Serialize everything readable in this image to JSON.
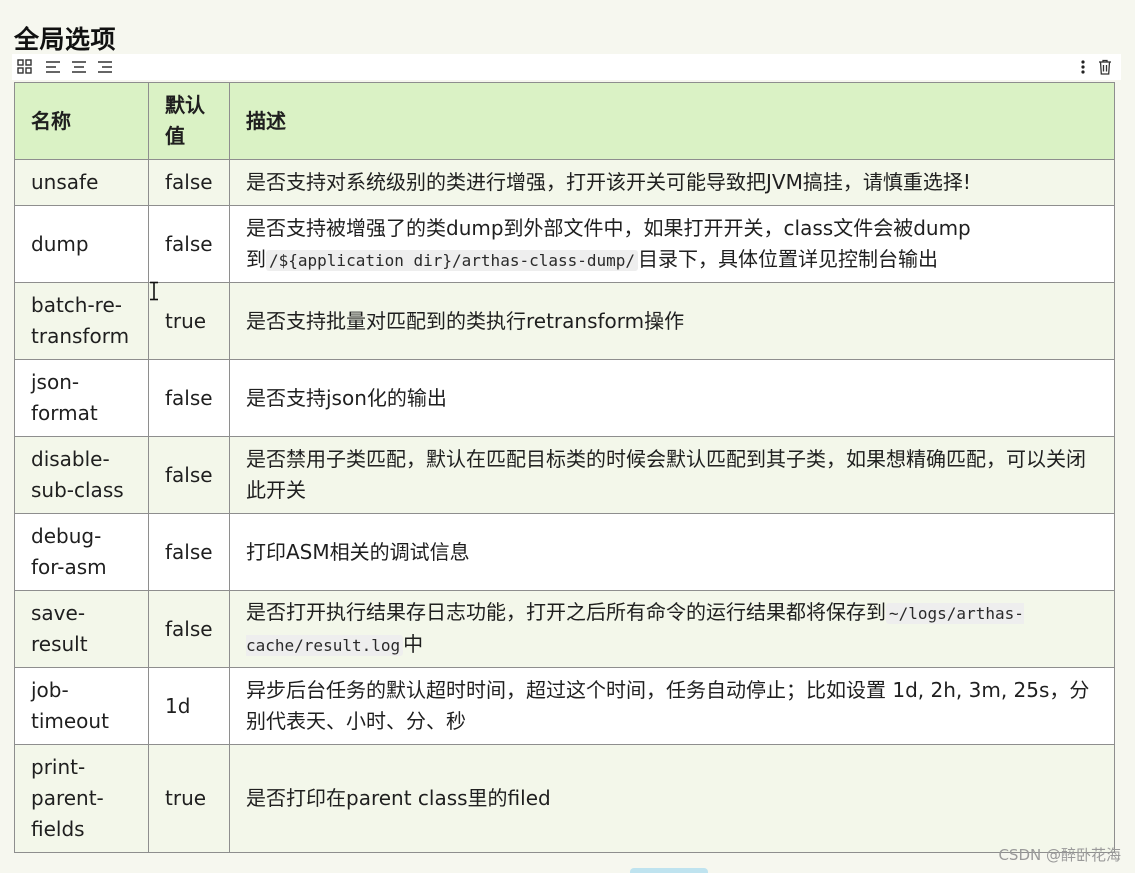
{
  "page": {
    "title": "全局选项"
  },
  "table": {
    "headers": {
      "name": "名称",
      "default": "默认值",
      "desc": "描述"
    },
    "rows": [
      {
        "name": "unsafe",
        "default": "false",
        "desc": "是否支持对系统级别的类进行增强，打开该开关可能导致把JVM搞挂，请慎重选择!"
      },
      {
        "name": "dump",
        "default": "false",
        "desc_a": "是否支持被增强了的类dump到外部文件中，如果打开开关，class文件会被dump到",
        "desc_code": "/${application dir}/arthas-class-dump/",
        "desc_b": "目录下，具体位置详见控制台输出"
      },
      {
        "name": "batch-re-transform",
        "default": "true",
        "desc": "是否支持批量对匹配到的类执行retransform操作"
      },
      {
        "name": "json-format",
        "default": "false",
        "desc": "是否支持json化的输出"
      },
      {
        "name": "disable-sub-class",
        "default": "false",
        "desc": "是否禁用子类匹配，默认在匹配目标类的时候会默认匹配到其子类，如果想精确匹配，可以关闭此开关"
      },
      {
        "name": "debug-for-asm",
        "default": "false",
        "desc": "打印ASM相关的调试信息"
      },
      {
        "name": "save-result",
        "default": "false",
        "desc_a": "是否打开执行结果存日志功能，打开之后所有命令的运行结果都将保存到",
        "desc_code": "~/logs/arthas-cache/result.log",
        "desc_b": "中"
      },
      {
        "name": "job-timeout",
        "default": "1d",
        "desc": "异步后台任务的默认超时时间，超过这个时间，任务自动停止；比如设置 1d, 2h, 3m, 25s，分别代表天、小时、分、秒"
      },
      {
        "name": "print-parent-fields",
        "default": "true",
        "desc": "是否打印在parent class里的filed"
      }
    ]
  },
  "toolbar": {
    "icons": [
      "grid-icon",
      "align-left-icon",
      "align-center-icon",
      "align-right-icon",
      "more-vertical-icon",
      "trash-icon"
    ]
  },
  "watermark": "CSDN @醉卧花海"
}
